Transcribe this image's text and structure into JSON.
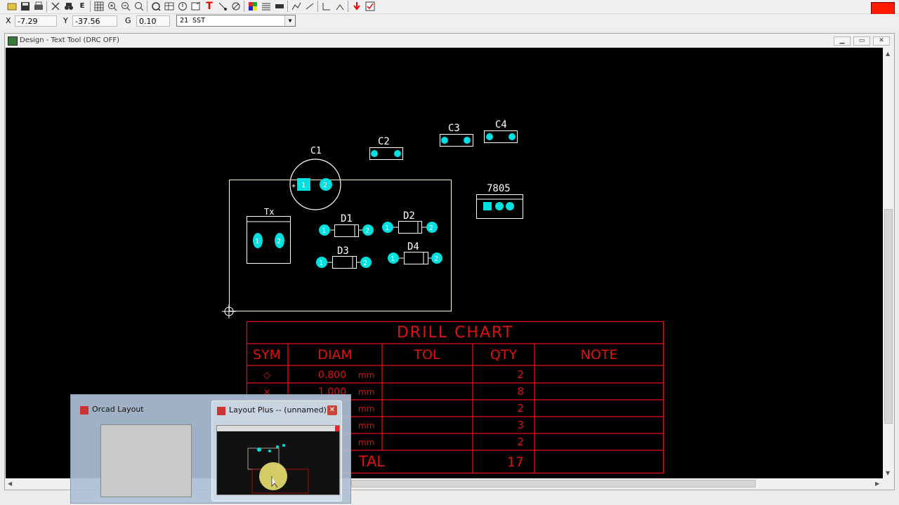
{
  "toolbar": {
    "icons": [
      "open-icon",
      "save-icon",
      "print-icon",
      "cut-icon",
      "binoculars-icon",
      "edit-icon",
      "grid-icon",
      "zoom-in-icon",
      "zoom-out-icon",
      "zoom-all-icon",
      "query-icon",
      "spreadsheet-icon",
      "drc-icon",
      "refresh-icon",
      "text-tool-icon",
      "route-icon",
      "no-connect-icon",
      "color-icon",
      "layers-icon",
      "component-icon",
      "autoroute-icon",
      "reconnect-icon",
      "undo-icon",
      "redo-icon",
      "error-icon",
      "check-icon"
    ],
    "text_tool_glyph": "T",
    "edit_glyph": "E",
    "accent_color": "#ff1a00"
  },
  "status": {
    "x_label": "X",
    "x_value": "-7.29",
    "y_label": "Y",
    "y_value": "-37.56",
    "g_label": "G",
    "g_value": "0.10",
    "layer": "21 SST"
  },
  "window": {
    "title": "Design - Text Tool (DRC OFF)"
  },
  "board": {
    "components": {
      "c1": "C1",
      "c2": "C2",
      "c3": "C3",
      "c4": "C4",
      "reg": "7805",
      "tx": "Tx",
      "d1": "D1",
      "d2": "D2",
      "d3": "D3",
      "d4": "D4"
    },
    "pin1": "1",
    "pin2": "2",
    "colors": {
      "pad": "#00e0e0",
      "outline": "#ffffff",
      "board": "#ffffe0",
      "chart": "#e01010"
    }
  },
  "drill_chart": {
    "title": "DRILL CHART",
    "headers": [
      "SYM",
      "DIAM",
      "TOL",
      "QTY",
      "NOTE"
    ],
    "rows": [
      {
        "sym": "◇",
        "diam": "0.800",
        "unit": "mm",
        "qty": "2"
      },
      {
        "sym": "×",
        "diam": "1.000",
        "unit": "mm",
        "qty": "8"
      },
      {
        "sym": "",
        "diam": "",
        "unit": "mm",
        "qty": "2"
      },
      {
        "sym": "",
        "diam": "",
        "unit": "mm",
        "qty": "3"
      },
      {
        "sym": "",
        "diam": "",
        "unit": "mm",
        "qty": "2"
      }
    ],
    "total_label": "TAL",
    "total_qty": "17"
  },
  "taskbar": {
    "windows": [
      {
        "title": "Orcad Layout"
      },
      {
        "title": "Layout Plus -- (unnamed)"
      }
    ],
    "close_glyph": "✕"
  }
}
